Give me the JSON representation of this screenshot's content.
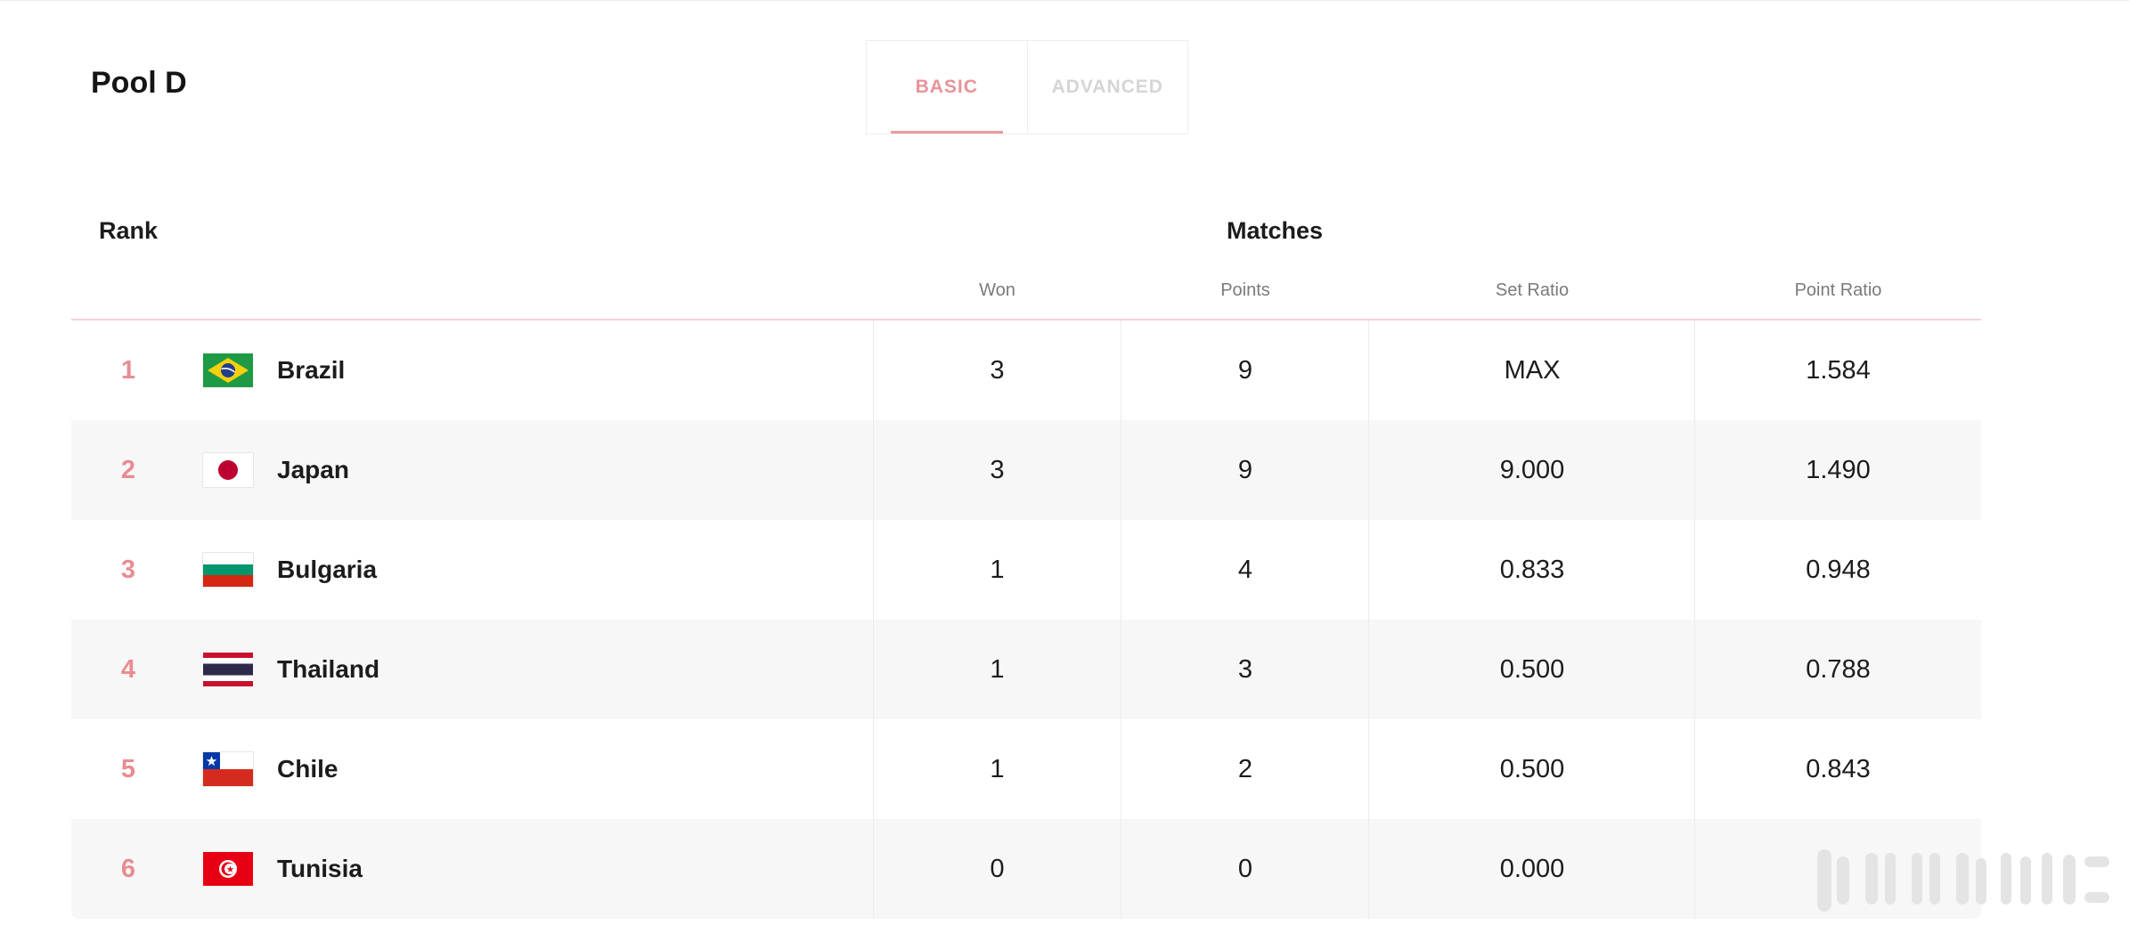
{
  "pool": {
    "title": "Pool D"
  },
  "tabs": {
    "basic": "BASIC",
    "advanced": "ADVANCED",
    "active": "basic"
  },
  "table": {
    "rank_header": "Rank",
    "matches_header": "Matches",
    "columns": {
      "won": "Won",
      "points": "Points",
      "set_ratio": "Set Ratio",
      "point_ratio": "Point Ratio"
    },
    "rows": [
      {
        "rank": "1",
        "team": "Brazil",
        "flag": "brazil-flag-icon",
        "won": "3",
        "points": "9",
        "set_ratio": "MAX",
        "point_ratio": "1.584"
      },
      {
        "rank": "2",
        "team": "Japan",
        "flag": "japan-flag-icon",
        "won": "3",
        "points": "9",
        "set_ratio": "9.000",
        "point_ratio": "1.490"
      },
      {
        "rank": "3",
        "team": "Bulgaria",
        "flag": "bulgaria-flag-icon",
        "won": "1",
        "points": "4",
        "set_ratio": "0.833",
        "point_ratio": "0.948"
      },
      {
        "rank": "4",
        "team": "Thailand",
        "flag": "thailand-flag-icon",
        "won": "1",
        "points": "3",
        "set_ratio": "0.500",
        "point_ratio": "0.788"
      },
      {
        "rank": "5",
        "team": "Chile",
        "flag": "chile-flag-icon",
        "won": "1",
        "points": "2",
        "set_ratio": "0.500",
        "point_ratio": "0.843"
      },
      {
        "rank": "6",
        "team": "Tunisia",
        "flag": "tunisia-flag-icon",
        "won": "0",
        "points": "0",
        "set_ratio": "0.000",
        "point_ratio": ""
      }
    ]
  },
  "colors": {
    "accent": "#e88c92",
    "tab_underline": "#ed9aa1",
    "row_alt": "#f7f7f7"
  }
}
